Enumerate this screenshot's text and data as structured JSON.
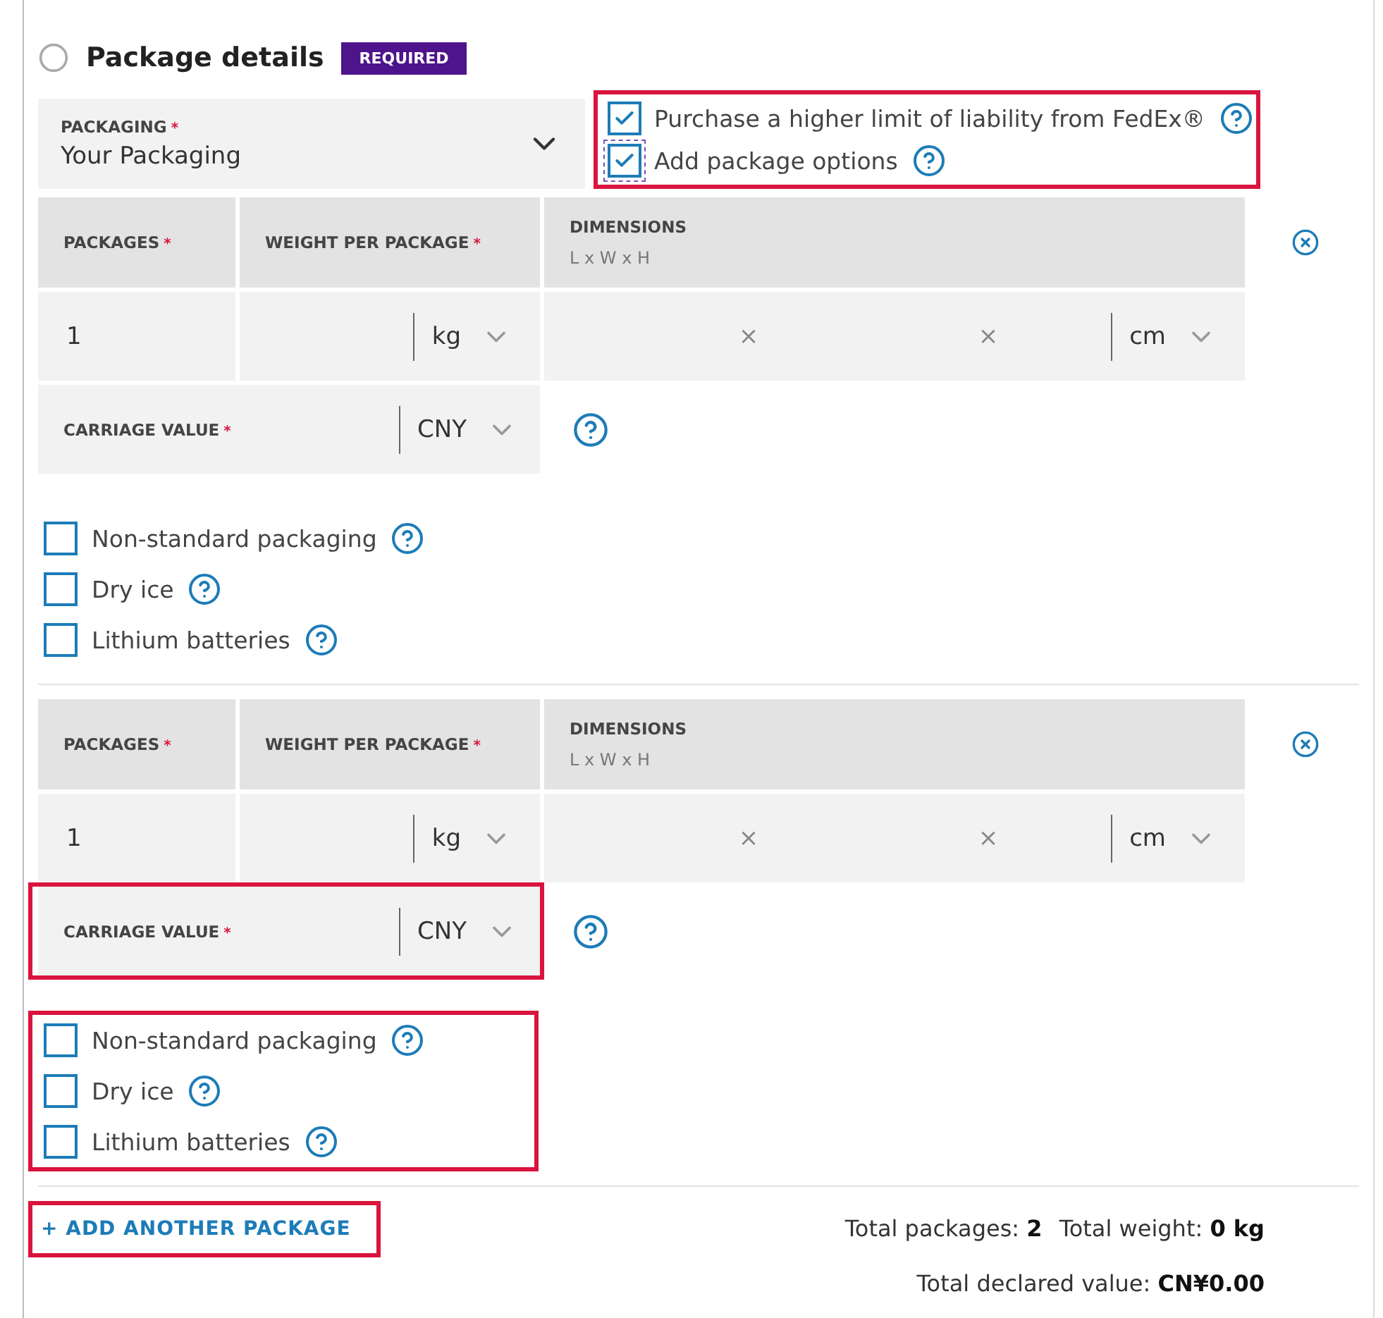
{
  "section": {
    "title": "Package details",
    "badge": "REQUIRED",
    "complete": false
  },
  "packaging": {
    "label": "PACKAGING",
    "mark": "*",
    "value": "Your Packaging"
  },
  "liability_options": {
    "highlighted": true,
    "items": [
      {
        "label": "Purchase a higher limit of liability from FedEx®",
        "checked": true,
        "focused": false
      },
      {
        "label": "Add package options",
        "checked": true,
        "focused": true
      }
    ]
  },
  "packages": [
    {
      "columns": [
        {
          "label": "PACKAGES",
          "mark": "*"
        },
        {
          "label": "WEIGHT PER PACKAGE",
          "mark": "*"
        },
        {
          "label": "DIMENSIONS",
          "sub": "L x W x H"
        }
      ],
      "count": "1",
      "weight_unit": "kg",
      "dim_separators": [
        "×",
        "×"
      ],
      "dim_unit": "cm",
      "carriage": {
        "label": "CARRIAGE VALUE",
        "mark": "*",
        "currency": "CNY",
        "highlighted": false
      },
      "options": {
        "highlighted": false,
        "items": [
          {
            "label": "Non-standard packaging",
            "checked": false
          },
          {
            "label": "Dry ice",
            "checked": false
          },
          {
            "label": "Lithium batteries",
            "checked": false
          }
        ]
      }
    },
    {
      "columns": [
        {
          "label": "PACKAGES",
          "mark": "*"
        },
        {
          "label": "WEIGHT PER PACKAGE",
          "mark": "*"
        },
        {
          "label": "DIMENSIONS",
          "sub": "L x W x H"
        }
      ],
      "count": "1",
      "weight_unit": "kg",
      "dim_separators": [
        "×",
        "×"
      ],
      "dim_unit": "cm",
      "carriage": {
        "label": "CARRIAGE VALUE",
        "mark": "*",
        "currency": "CNY",
        "highlighted": true
      },
      "options": {
        "highlighted": true,
        "items": [
          {
            "label": "Non-standard packaging",
            "checked": false
          },
          {
            "label": "Dry ice",
            "checked": false
          },
          {
            "label": "Lithium batteries",
            "checked": false
          }
        ]
      }
    }
  ],
  "add_package": {
    "label": "+ ADD ANOTHER PACKAGE",
    "highlighted": true
  },
  "totals": [
    [
      {
        "label": "Total packages:",
        "value": "2"
      },
      {
        "label": "Total weight:",
        "value": "0 kg"
      }
    ],
    [
      {
        "label": "Total declared value:",
        "value": "CN¥0.00"
      }
    ]
  ]
}
